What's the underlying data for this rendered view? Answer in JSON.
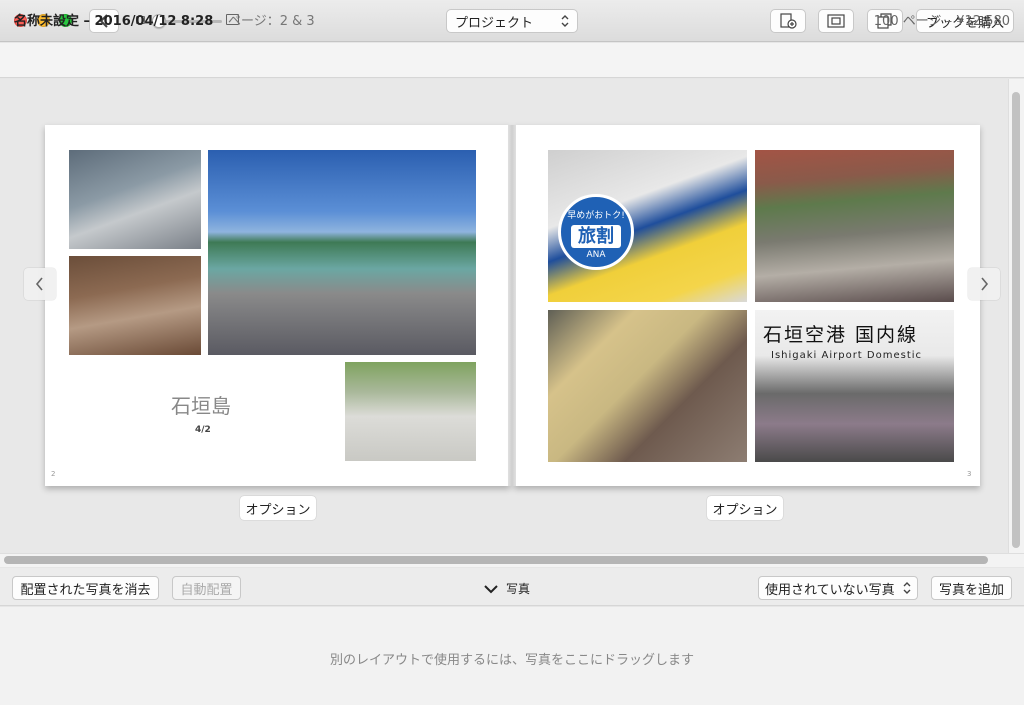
{
  "toolbar": {
    "project_label": "プロジェクト",
    "buy_label": "ブックを購入"
  },
  "info": {
    "doc_title": "名称未設定 – 2016/04/12 8:28",
    "page_info": "ページ：2 & 3",
    "price": "100 ページ – ¥12,580"
  },
  "spread": {
    "left_page": {
      "title": "石垣島",
      "date": "4/2",
      "page_number": "2",
      "option_label": "オプション"
    },
    "right_page": {
      "page_number": "3",
      "option_label": "オプション",
      "sign_text": "石垣空港 国内線",
      "sign_sub": "Ishigaki Airport Domestic",
      "badge_line1": "早めがおトク!",
      "badge_main": "旅割",
      "badge_brand": "ANA"
    }
  },
  "panel": {
    "clear_label": "配置された写真を消去",
    "auto_label": "自動配置",
    "photos_label": "写真",
    "filter_label": "使用されていない写真",
    "add_label": "写真を追加",
    "drop_hint": "別のレイアウトで使用するには、写真をここにドラッグします"
  }
}
